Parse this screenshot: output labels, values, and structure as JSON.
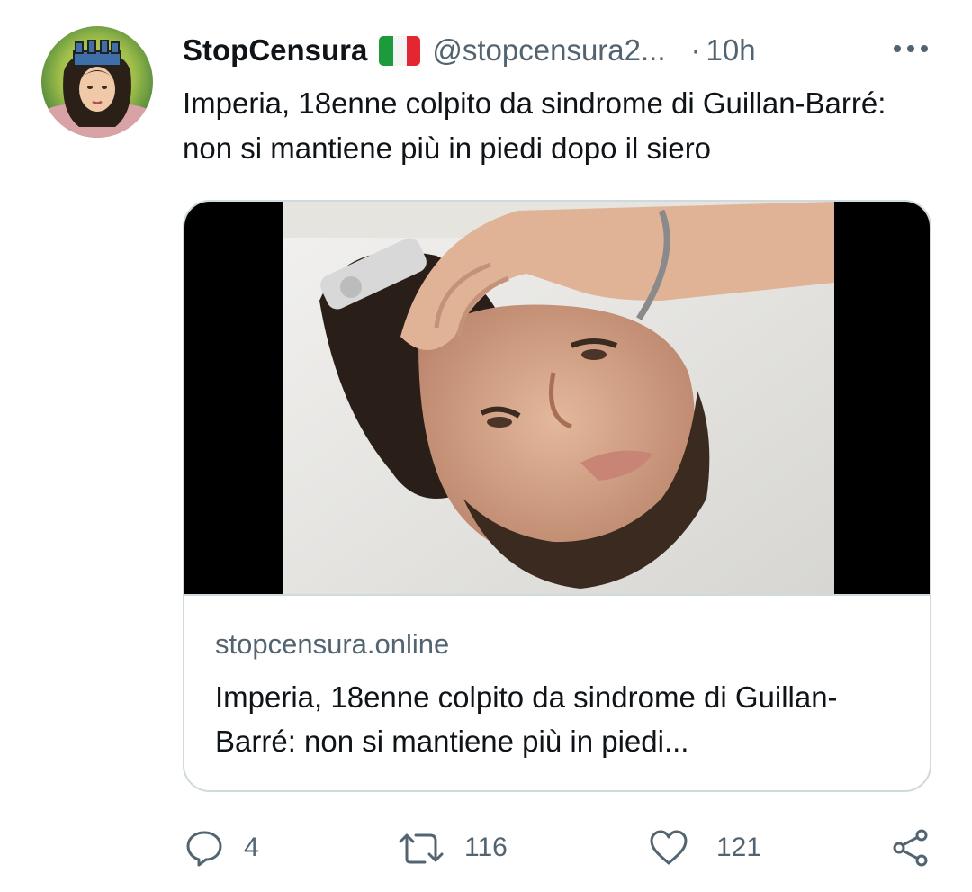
{
  "tweet": {
    "author_name": "StopCensura",
    "author_flag": "italy-flag-icon",
    "handle": "@stopcensura2...",
    "separator": "·",
    "time": "10h",
    "text": "Imperia, 18enne colpito da sindrome di Guillan-Barré: non si mantiene più in piedi dopo il siero"
  },
  "card": {
    "domain": "stopcensura.online",
    "title": "Imperia, 18enne colpito da sindrome di Guillan-Barré: non si mantiene più in piedi..."
  },
  "actions": {
    "reply": {
      "icon": "reply-icon",
      "count": "4"
    },
    "retweet": {
      "icon": "retweet-icon",
      "count": "116"
    },
    "like": {
      "icon": "heart-icon",
      "count": "121"
    },
    "share": {
      "icon": "share-icon"
    }
  },
  "colors": {
    "text": "#0f1419",
    "secondary": "#536471",
    "border": "#cfd9de"
  }
}
